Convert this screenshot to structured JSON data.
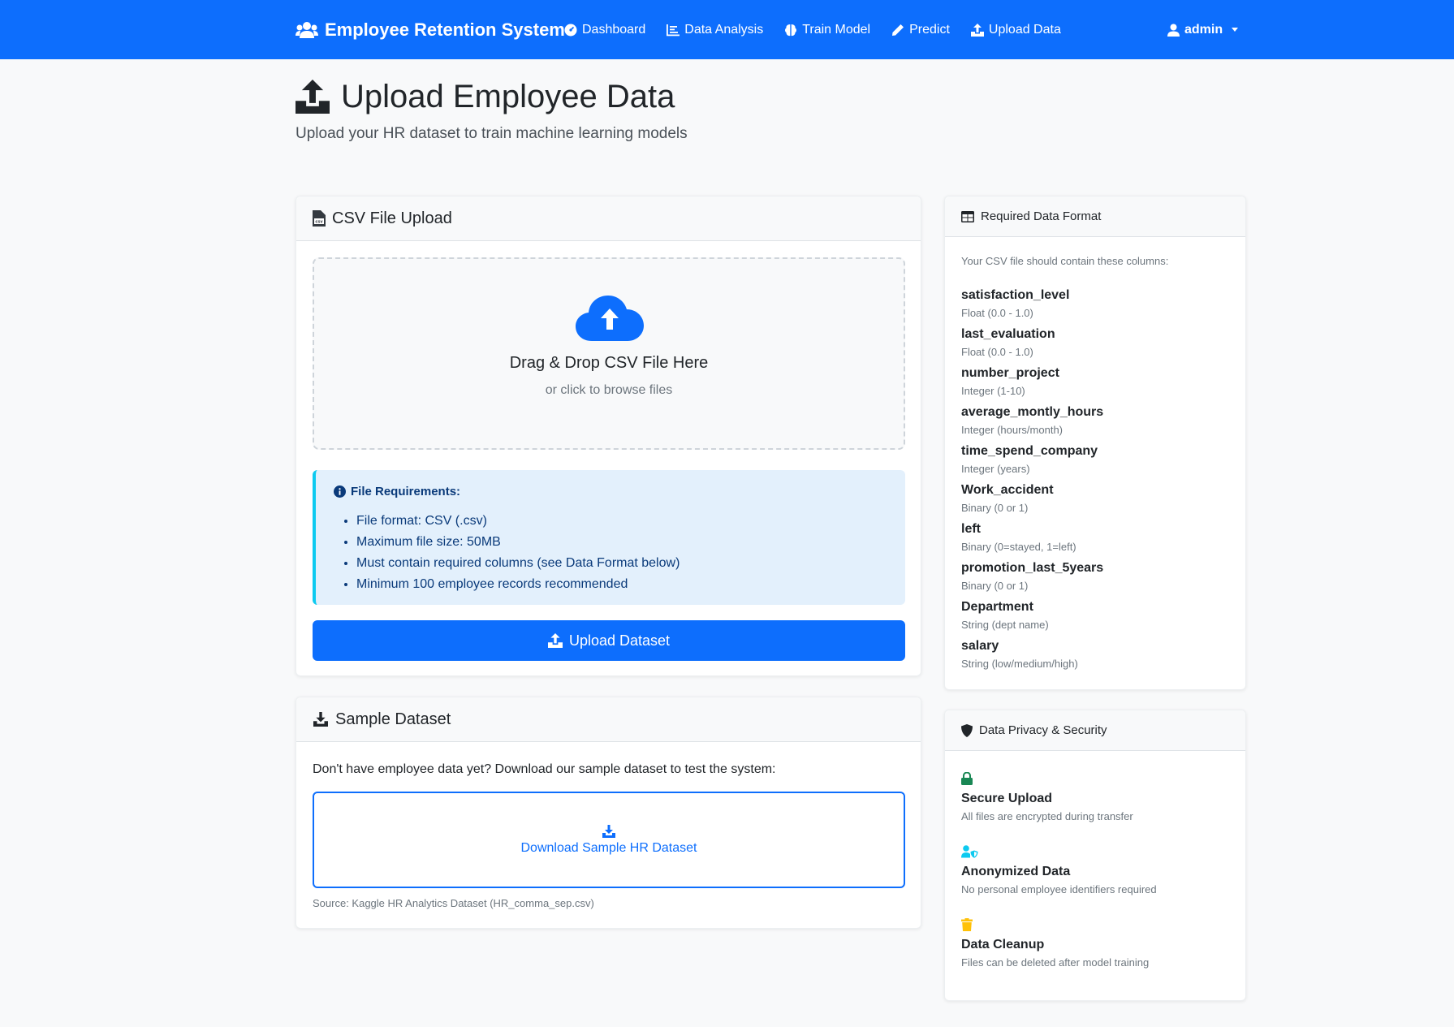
{
  "navbar": {
    "brand": "Employee Retention System",
    "links": [
      {
        "label": "Dashboard",
        "icon": "tachometer-icon"
      },
      {
        "label": "Data Analysis",
        "icon": "chart-icon"
      },
      {
        "label": "Train Model",
        "icon": "brain-icon"
      },
      {
        "label": "Predict",
        "icon": "pencil-icon"
      },
      {
        "label": "Upload Data",
        "icon": "upload-icon"
      }
    ],
    "user": "admin"
  },
  "header": {
    "title": "Upload Employee Data",
    "subtitle": "Upload your HR dataset to train machine learning models"
  },
  "upload_card": {
    "title": "CSV File Upload",
    "dropzone_title": "Drag & Drop CSV File Here",
    "dropzone_sub": "or click to browse files",
    "requirements_title": "File Requirements:",
    "requirements": [
      "File format: CSV (.csv)",
      "Maximum file size: 50MB",
      "Must contain required columns (see Data Format below)",
      "Minimum 100 employee records recommended"
    ],
    "button": "Upload Dataset"
  },
  "sample_card": {
    "title": "Sample Dataset",
    "text": "Don't have employee data yet? Download our sample dataset to test the system:",
    "button": "Download Sample HR Dataset",
    "source": "Source: Kaggle HR Analytics Dataset (HR_comma_sep.csv)"
  },
  "format_card": {
    "title": "Required Data Format",
    "intro": "Your CSV file should contain these columns:",
    "fields": [
      {
        "name": "satisfaction_level",
        "desc": "Float (0.0 - 1.0)"
      },
      {
        "name": "last_evaluation",
        "desc": "Float (0.0 - 1.0)"
      },
      {
        "name": "number_project",
        "desc": "Integer (1-10)"
      },
      {
        "name": "average_montly_hours",
        "desc": "Integer (hours/month)"
      },
      {
        "name": "time_spend_company",
        "desc": "Integer (years)"
      },
      {
        "name": "Work_accident",
        "desc": "Binary (0 or 1)"
      },
      {
        "name": "left",
        "desc": "Binary (0=stayed, 1=left)"
      },
      {
        "name": "promotion_last_5years",
        "desc": "Binary (0 or 1)"
      },
      {
        "name": "Department",
        "desc": "String (dept name)"
      },
      {
        "name": "salary",
        "desc": "String (low/medium/high)"
      }
    ]
  },
  "privacy_card": {
    "title": "Data Privacy & Security",
    "items": [
      {
        "title": "Secure Upload",
        "desc": "All files are encrypted during transfer",
        "icon": "lock-icon",
        "color": "#198754"
      },
      {
        "title": "Anonymized Data",
        "desc": "No personal employee identifiers required",
        "icon": "user-shield-icon",
        "color": "#0dcaf0"
      },
      {
        "title": "Data Cleanup",
        "desc": "Files can be deleted after model training",
        "icon": "trash-icon",
        "color": "#ffc107"
      }
    ]
  },
  "colors": {
    "primary": "#0d6efd",
    "info": "#0dcaf0",
    "success": "#198754",
    "warning": "#ffc107"
  }
}
